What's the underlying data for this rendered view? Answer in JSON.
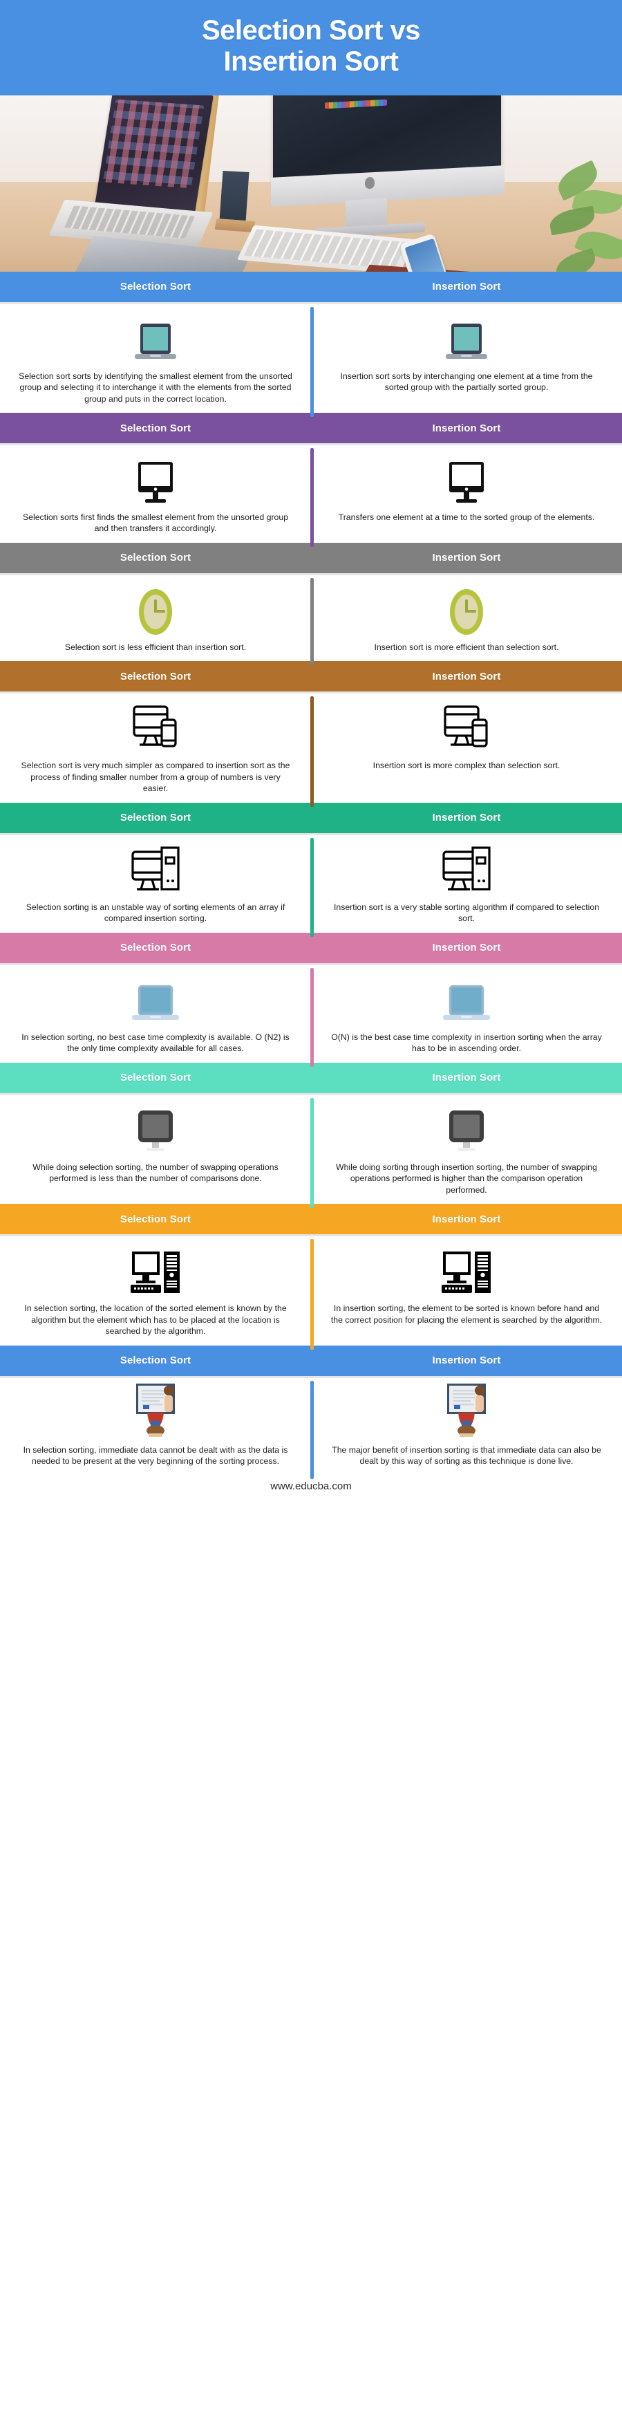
{
  "title": {
    "line1": "Selection Sort vs",
    "line2": "Insertion Sort"
  },
  "hero": {
    "alt": "desk with imac laptop keyboard tablet phone and plant"
  },
  "labels": {
    "left": "Selection Sort",
    "right": "Insertion Sort"
  },
  "footer": {
    "url": "www.educba.com"
  },
  "colors": {
    "title_bg": "#4a90e2",
    "band1": "#4a90e2",
    "band2": "#7a519e",
    "band3": "#808080",
    "band4": "#b1702b",
    "band5": "#1fb287",
    "band6": "#d униq",
    "band7": "#5bdfc0",
    "band8": "#f5a623",
    "band9": "#4a90e2"
  },
  "rows": [
    {
      "band_color": "#4a90e2",
      "divider_color": "#4a90e2",
      "icon": "laptop-teal-icon",
      "left_label": "Selection Sort",
      "right_label": "Insertion Sort",
      "left_text": "Selection sort sorts by identifying the smallest element from the unsorted group and selecting it to interchange it with the elements from the sorted group and puts in the correct location.",
      "right_text": "Insertion sort sorts by interchanging one element at a time from the sorted group with the partially sorted group."
    },
    {
      "band_color": "#7a519e",
      "divider_color": "#7a519e",
      "icon": "monitor-black-icon",
      "left_label": "Selection Sort",
      "right_label": "Insertion Sort",
      "left_text": "Selection sorts first finds the smallest element from the unsorted group and then transfers it accordingly.",
      "right_text": "Transfers one element at a time to the sorted group of the elements."
    },
    {
      "band_color": "#808080",
      "divider_color": "#808080",
      "icon": "clock-olive-icon",
      "left_label": "Selection Sort",
      "right_label": "Insertion Sort",
      "left_text": "Selection sort is less efficient than insertion sort.",
      "right_text": "Insertion sort is more efficient than selection sort."
    },
    {
      "band_color": "#b1702b",
      "divider_color": "#8f5a22",
      "icon": "monitor-phone-outline-icon",
      "left_label": "Selection Sort",
      "right_label": "Insertion Sort",
      "left_text": "Selection sort is very much simpler as compared to insertion sort as the process of finding smaller number from a group of numbers is very easier.",
      "right_text": "Insertion sort is more complex than selection sort."
    },
    {
      "band_color": "#1fb287",
      "divider_color": "#1fb287",
      "icon": "desktop-tower-outline-icon",
      "left_label": "Selection Sort",
      "right_label": "Insertion Sort",
      "left_text": "Selection sorting is an unstable way of sorting elements of an array if compared insertion sorting.",
      "right_text": "Insertion sort is a very stable sorting algorithm if compared to selection sort."
    },
    {
      "band_color": "#d87aa8",
      "divider_color": "#d87aa8",
      "icon": "laptop-blue-icon",
      "left_label": "Selection Sort",
      "right_label": "Insertion Sort",
      "left_text": "In selection sorting, no best case time complexity is available. O (N2) is the only time complexity available for all cases.",
      "right_text": "O(N) is the best case time complexity in insertion sorting when the array has to be in ascending order."
    },
    {
      "band_color": "#5bdfc0",
      "divider_color": "#5bdfc0",
      "icon": "monitor-grey-icon",
      "left_label": "Selection Sort",
      "right_label": "Insertion Sort",
      "left_text": "While doing selection sorting, the number of swapping operations performed is less than the number of comparisons done.",
      "right_text": "While doing sorting through insertion sorting, the number of swapping operations performed is higher than the comparison operation performed."
    },
    {
      "band_color": "#f5a623",
      "divider_color": "#f5a623",
      "icon": "pc-tower-monitor-icon",
      "left_label": "Selection Sort",
      "right_label": "Insertion Sort",
      "left_text": "In selection sorting, the location of the sorted element is known by the algorithm but the element which has to be placed at the location is searched by the algorithm.",
      "right_text": "In insertion sorting, the element to be sorted is known before hand and the correct position for placing the element is searched by the algorithm."
    },
    {
      "band_color": "#4a90e2",
      "divider_color": "#4a90e2",
      "icon": "person-presentation-icon",
      "left_label": "Selection Sort",
      "right_label": "Insertion Sort",
      "left_text": "In selection sorting, immediate data cannot be dealt with as the data is needed to be present at the very beginning of the sorting process.",
      "right_text": "The major benefit of insertion sorting is that immediate data can also be dealt by this way of sorting as this technique is done live."
    }
  ]
}
